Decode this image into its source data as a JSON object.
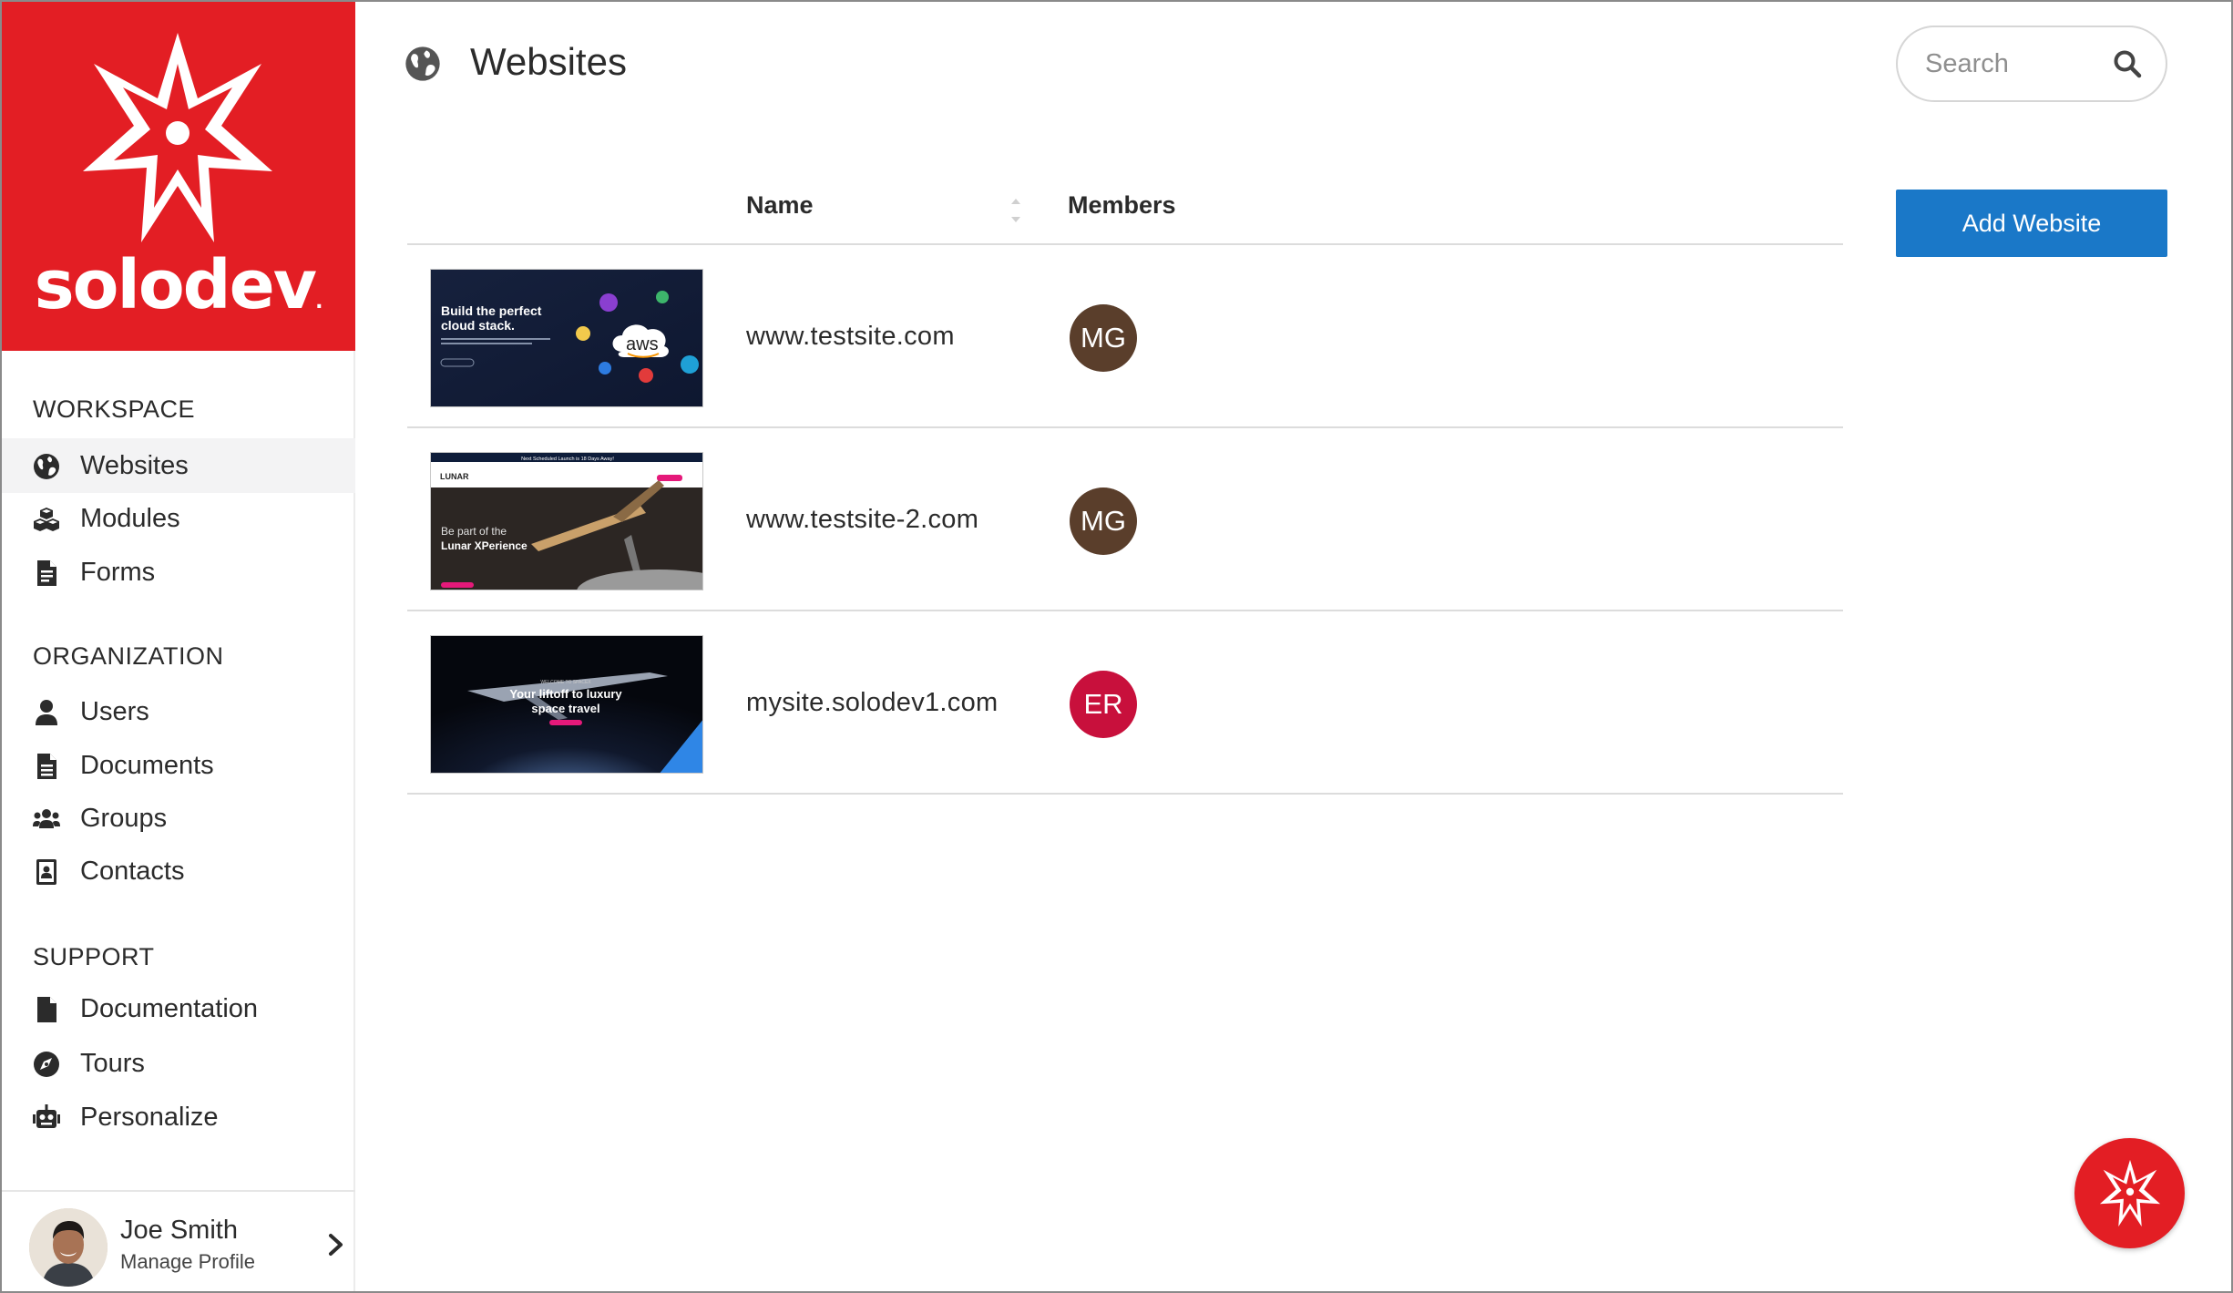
{
  "brand": {
    "name": "solodev",
    "dot": ".",
    "color": "#e31e24"
  },
  "sidebar": {
    "sections": [
      {
        "title": "WORKSPACE",
        "items": [
          {
            "label": "Websites",
            "icon": "globe-icon",
            "active": true
          },
          {
            "label": "Modules",
            "icon": "cubes-icon"
          },
          {
            "label": "Forms",
            "icon": "form-doc-icon"
          }
        ]
      },
      {
        "title": "ORGANIZATION",
        "items": [
          {
            "label": "Users",
            "icon": "user-icon"
          },
          {
            "label": "Documents",
            "icon": "document-icon"
          },
          {
            "label": "Groups",
            "icon": "users-group-icon"
          },
          {
            "label": "Contacts",
            "icon": "contact-card-icon"
          }
        ]
      },
      {
        "title": "SUPPORT",
        "items": [
          {
            "label": "Documentation",
            "icon": "file-icon"
          },
          {
            "label": "Tours",
            "icon": "compass-icon"
          },
          {
            "label": "Personalize",
            "icon": "robot-icon"
          }
        ]
      }
    ],
    "profile": {
      "name": "Joe Smith",
      "subtitle": "Manage Profile",
      "icon": "chevron-right-icon"
    }
  },
  "header": {
    "title": "Websites",
    "icon": "globe-icon"
  },
  "search": {
    "placeholder": "Search",
    "icon": "search-icon"
  },
  "actions": {
    "add_label": "Add Website",
    "accent": "#1a78c8"
  },
  "table": {
    "columns": {
      "name": "Name",
      "members": "Members"
    },
    "rows": [
      {
        "name": "www.testsite.com",
        "member": {
          "initials": "MG",
          "color": "#5a3e2b"
        },
        "thumb": {
          "headline1": "Build the perfect",
          "headline2": "cloud stack.",
          "badge": "aws"
        }
      },
      {
        "name": "www.testsite-2.com",
        "member": {
          "initials": "MG",
          "color": "#5a3e2b"
        },
        "thumb": {
          "topbar": "Next Scheduled Launch is 18 Days Away!",
          "logo": "LUNAR",
          "line1": "Be part of the",
          "line2": "Lunar XPerience"
        }
      },
      {
        "name": "mysite.solodev1.com",
        "member": {
          "initials": "ER",
          "color": "#c8103c"
        },
        "thumb": {
          "kicker": "WELCOME TO SPACEX",
          "line1": "Your liftoff to luxury",
          "line2": "space travel"
        }
      }
    ]
  },
  "fab": {
    "icon": "solodev-star-icon"
  }
}
